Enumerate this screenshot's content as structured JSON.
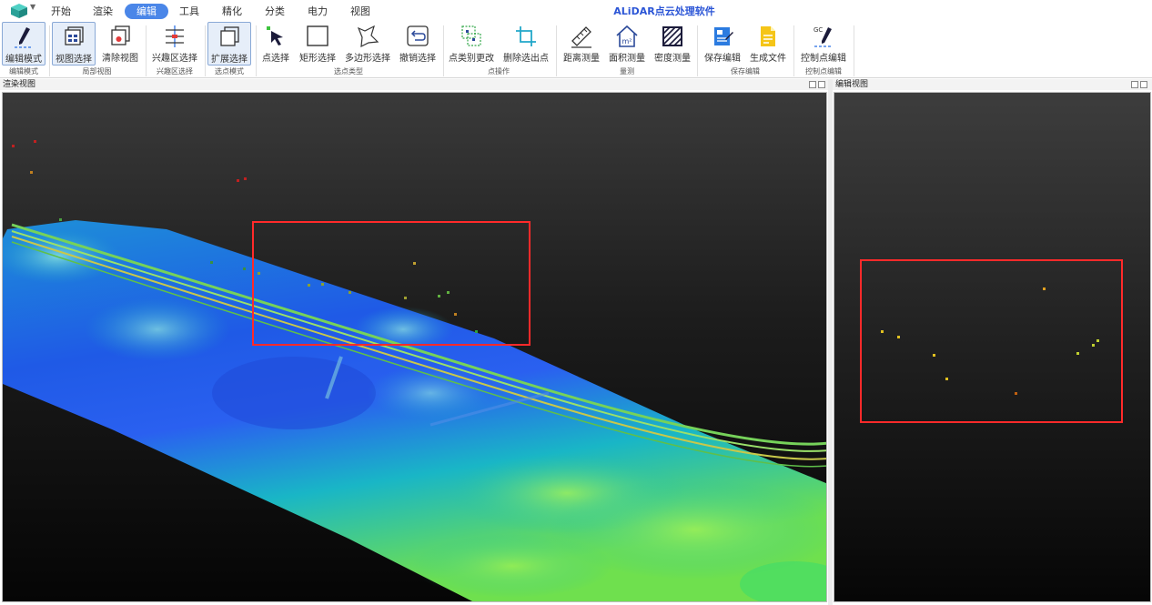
{
  "app_title": "ALiDAR点云处理软件",
  "menu": {
    "tabs": [
      "开始",
      "渲染",
      "编辑",
      "工具",
      "精化",
      "分类",
      "电力",
      "视图"
    ],
    "active_tab": "编辑"
  },
  "ribbon": {
    "buttons": {
      "edit_mode": "编辑模式",
      "view_select": "视图选择",
      "clear_view": "清除视图",
      "roi_select": "兴趣区选择",
      "expand_select": "扩展选择",
      "point_select": "点选择",
      "rect_select": "矩形选择",
      "polygon_select": "多边形选择",
      "undo_select": "撤销选择",
      "change_class": "点类别更改",
      "delete_selected": "删除选出点",
      "distance_measure": "距离测量",
      "area_measure": "面积测量",
      "density_measure": "密度测量",
      "save_edit": "保存编辑",
      "generate_file": "生成文件",
      "control_point_edit": "控制点编辑"
    },
    "groups": {
      "edit_mode": "编辑模式",
      "local_view": "局部视图",
      "roi_select": "兴趣区选择",
      "select_mode": "选点模式",
      "select_type": "选点类型",
      "point_ops": "点操作",
      "measure": "量测",
      "save_edit": "保存编辑",
      "control_point_edit": "控制点编辑"
    },
    "icon_names": [
      "pencil-icon",
      "grid-window-icon",
      "clear-view-icon",
      "roi-icon",
      "expand-window-icon",
      "cursor-icon",
      "rectangle-icon",
      "polygon-icon",
      "undo-icon",
      "class-change-icon",
      "crop-icon",
      "ruler-icon",
      "house-area-icon",
      "density-hatch-icon",
      "save-edit-icon",
      "file-icon",
      "gc-pencil-icon"
    ],
    "gc_label": "GC",
    "area_unit": "m²"
  },
  "panels": {
    "render_title": "渲染视图",
    "edit_title": "编辑视图"
  },
  "colors": {
    "accent": "#4a86e8",
    "title": "#2b55d6",
    "selection": "#ff2a2a"
  }
}
